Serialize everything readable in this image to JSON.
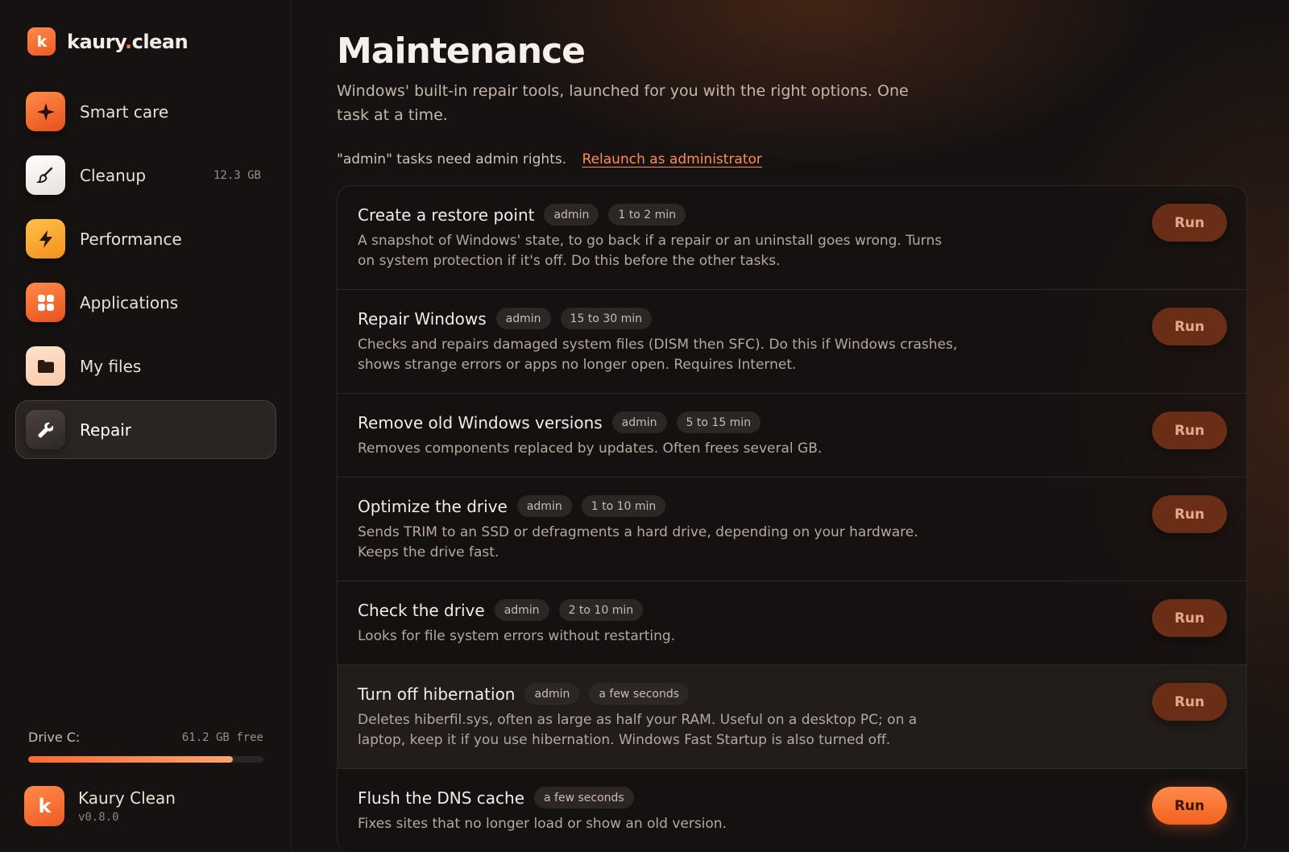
{
  "brand": {
    "logo_text": "k",
    "name_part1": "kaury",
    "name_dot": ".",
    "name_part2": "clean"
  },
  "nav": {
    "items": [
      {
        "label": "Smart care",
        "meta": ""
      },
      {
        "label": "Cleanup",
        "meta": "12.3 GB"
      },
      {
        "label": "Performance",
        "meta": ""
      },
      {
        "label": "Applications",
        "meta": ""
      },
      {
        "label": "My files",
        "meta": ""
      },
      {
        "label": "Repair",
        "meta": "",
        "active": true
      }
    ]
  },
  "drive": {
    "label": "Drive C:",
    "free": "61.2 GB free",
    "used_fraction": 0.87
  },
  "app": {
    "name": "Kaury Clean",
    "version": "v0.8.0",
    "logo_text": "k"
  },
  "page": {
    "title": "Maintenance",
    "description": "Windows' built-in repair tools, launched for you with the right options. One task at a time.",
    "admin_note": "\"admin\" tasks need admin rights.",
    "admin_link": "Relaunch as administrator"
  },
  "run_label": "Run",
  "tasks": [
    {
      "title": "Create a restore point",
      "tags": [
        "admin",
        "1 to 2 min"
      ],
      "desc": "A snapshot of Windows' state, to go back if a repair or an uninstall goes wrong. Turns on system protection if it's off. Do this before the other tasks."
    },
    {
      "title": "Repair Windows",
      "tags": [
        "admin",
        "15 to 30 min"
      ],
      "desc": "Checks and repairs damaged system files (DISM then SFC). Do this if Windows crashes, shows strange errors or apps no longer open. Requires Internet."
    },
    {
      "title": "Remove old Windows versions",
      "tags": [
        "admin",
        "5 to 15 min"
      ],
      "desc": "Removes components replaced by updates. Often frees several GB."
    },
    {
      "title": "Optimize the drive",
      "tags": [
        "admin",
        "1 to 10 min"
      ],
      "desc": "Sends TRIM to an SSD or defragments a hard drive, depending on your hardware. Keeps the drive fast."
    },
    {
      "title": "Check the drive",
      "tags": [
        "admin",
        "2 to 10 min"
      ],
      "desc": "Looks for file system errors without restarting."
    },
    {
      "title": "Turn off hibernation",
      "tags": [
        "admin",
        "a few seconds"
      ],
      "desc": "Deletes hiberfil.sys, often as large as half your RAM. Useful on a desktop PC; on a laptop, keep it if you use hibernation. Windows Fast Startup is also turned off."
    },
    {
      "title": "Flush the DNS cache",
      "tags": [
        "a few seconds"
      ],
      "desc": "Fixes sites that no longer load or show an old version."
    }
  ],
  "colors": {
    "accent": "#ff7a3d",
    "run_button": "#6a2e17",
    "run_button_primary": "#f2621f"
  }
}
